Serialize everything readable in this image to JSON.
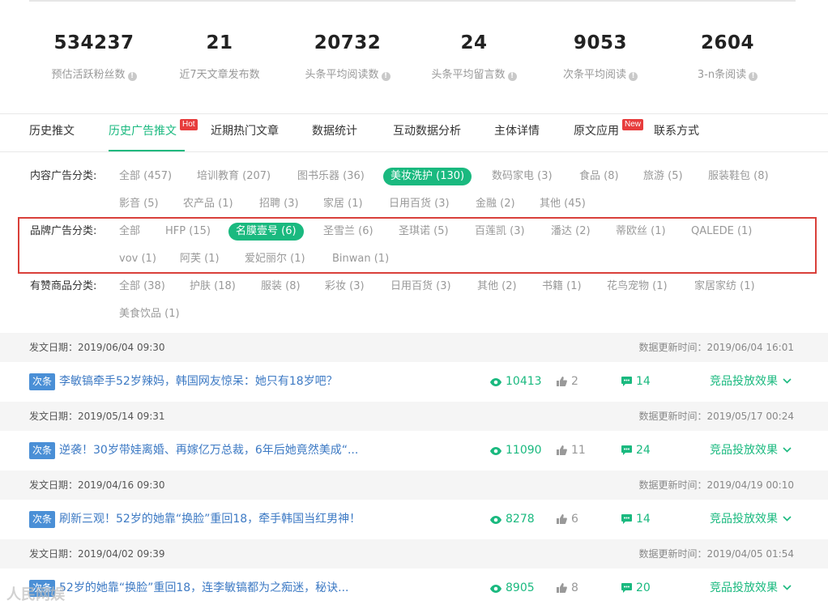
{
  "stats": [
    {
      "value": "534237",
      "label": "预估活跃粉丝数"
    },
    {
      "value": "21",
      "label": "近7天文章发布数"
    },
    {
      "value": "20732",
      "label": "头条平均阅读数"
    },
    {
      "value": "24",
      "label": "头条平均留言数"
    },
    {
      "value": "9053",
      "label": "次条平均阅读"
    },
    {
      "value": "2604",
      "label": "3-n条阅读"
    }
  ],
  "tabs": [
    {
      "label": "历史推文"
    },
    {
      "label": "历史广告推文",
      "badge": "Hot"
    },
    {
      "label": "近期热门文章"
    },
    {
      "label": "数据统计"
    },
    {
      "label": "互动数据分析"
    },
    {
      "label": "主体详情"
    },
    {
      "label": "原文应用",
      "badge": "New"
    },
    {
      "label": "联系方式"
    }
  ],
  "filters": {
    "content": {
      "label": "内容广告分类:",
      "items": [
        "全部 (457)",
        "培训教育 (207)",
        "图书乐器 (36)",
        "美妆洗护 (130)",
        "数码家电 (3)",
        "食品 (8)",
        "旅游 (5)",
        "服装鞋包 (8)",
        "影音 (5)",
        "农产品 (1)",
        "招聘 (3)",
        "家居 (1)",
        "日用百货 (3)",
        "金融 (2)",
        "其他 (45)"
      ]
    },
    "brand": {
      "label": "品牌广告分类:",
      "items": [
        "全部",
        "HFP (15)",
        "名膜壹号 (6)",
        "圣雪兰 (6)",
        "圣琪诺 (5)",
        "百莲凯 (3)",
        "潘达 (2)",
        "蒂欧丝 (1)",
        "QALEDE (1)",
        "vov (1)",
        "阿芙 (1)",
        "爱妃丽尔 (1)",
        "Binwan (1)"
      ]
    },
    "goods": {
      "label": "有赞商品分类:",
      "items": [
        "全部 (38)",
        "护肤 (18)",
        "服装 (8)",
        "彩妆 (3)",
        "日用百货 (3)",
        "其他 (2)",
        "书籍 (1)",
        "花鸟宠物 (1)",
        "家居家纺 (1)",
        "美食饮品 (1)"
      ]
    }
  },
  "articles": [
    {
      "publish": "发文日期：2019/06/04 09:30",
      "updated": "数据更新时间：2019/06/04 16:01",
      "tag": "次条",
      "title": "李敏镐牵手52岁辣妈，韩国网友惊呆：她只有18岁吧？",
      "reads": "10413",
      "likes": "2",
      "comments": "14",
      "effect": "竞品投放效果"
    },
    {
      "publish": "发文日期：2019/05/14 09:31",
      "updated": "数据更新时间：2019/05/17 00:24",
      "tag": "次条",
      "title": "逆袭！30岁带娃离婚、再嫁亿万总裁，6年后她竟然美成“...",
      "reads": "11090",
      "likes": "11",
      "comments": "24",
      "effect": "竞品投放效果"
    },
    {
      "publish": "发文日期：2019/04/16 09:30",
      "updated": "数据更新时间：2019/04/19 00:10",
      "tag": "次条",
      "title": "刷新三观！52岁的她靠“换脸”重回18，牵手韩国当红男神！",
      "reads": "8278",
      "likes": "6",
      "comments": "14",
      "effect": "竞品投放效果"
    },
    {
      "publish": "发文日期：2019/04/02 09:39",
      "updated": "数据更新时间：2019/04/05 01:54",
      "tag": "次条",
      "title": "52岁的她靠“换脸”重回18，连李敏镐都为之痴迷，秘诀...",
      "reads": "8905",
      "likes": "8",
      "comments": "20",
      "effect": "竞品投放效果"
    }
  ],
  "watermark": "人民网娱",
  "colors": {
    "accent": "#1ab97f",
    "link": "#3d7ac4",
    "tag": "#4a8fd6",
    "badge": "#e73c3c",
    "highlight_box": "#d9403a"
  }
}
